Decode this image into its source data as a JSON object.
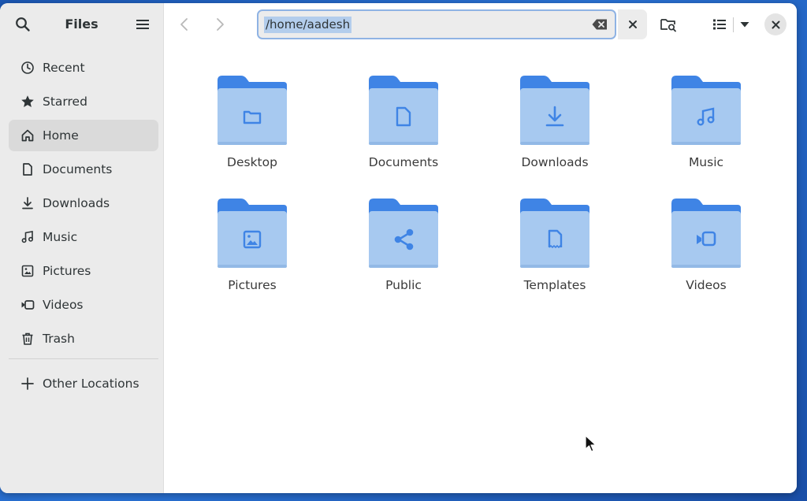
{
  "sidebar": {
    "title": "Files",
    "items": [
      {
        "label": "Recent",
        "icon": "clock-icon"
      },
      {
        "label": "Starred",
        "icon": "star-icon"
      },
      {
        "label": "Home",
        "icon": "home-icon",
        "active": true
      },
      {
        "label": "Documents",
        "icon": "document-icon"
      },
      {
        "label": "Downloads",
        "icon": "download-icon"
      },
      {
        "label": "Music",
        "icon": "music-icon"
      },
      {
        "label": "Pictures",
        "icon": "image-icon"
      },
      {
        "label": "Videos",
        "icon": "video-icon"
      },
      {
        "label": "Trash",
        "icon": "trash-icon"
      }
    ],
    "other_locations": "Other Locations"
  },
  "toolbar": {
    "path": "/home/aadesh"
  },
  "folders": [
    {
      "label": "Desktop",
      "emblem": "folder-emblem"
    },
    {
      "label": "Documents",
      "emblem": "document-emblem"
    },
    {
      "label": "Downloads",
      "emblem": "download-emblem"
    },
    {
      "label": "Music",
      "emblem": "music-emblem"
    },
    {
      "label": "Pictures",
      "emblem": "image-emblem"
    },
    {
      "label": "Public",
      "emblem": "share-emblem"
    },
    {
      "label": "Templates",
      "emblem": "template-emblem"
    },
    {
      "label": "Videos",
      "emblem": "video-emblem"
    }
  ],
  "colors": {
    "folder_back": "#3f84e5",
    "folder_front": "#a7c9f0",
    "emblem": "#3f84e5",
    "sidebar_bg": "#ebebeb",
    "selection": "#b3cdec"
  }
}
